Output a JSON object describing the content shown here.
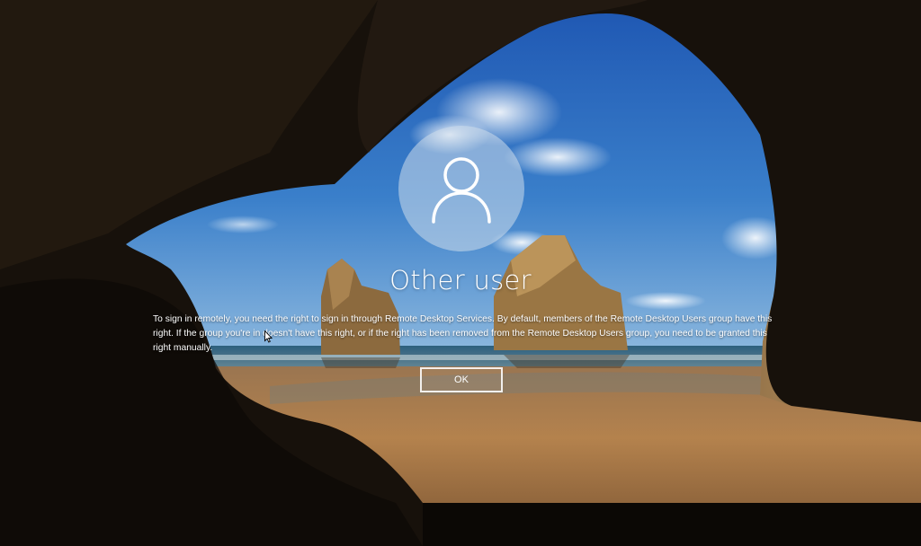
{
  "lock_screen": {
    "user": {
      "avatar_icon": "user-silhouette-icon",
      "name": "Other user"
    },
    "message": "To sign in remotely, you need the right to sign in through Remote Desktop Services. By default, members of the Remote Desktop Users group have this right. If the group you're in doesn't have this right, or if the right has been removed from the Remote Desktop Users group, you need to be granted this right manually.",
    "ok_label": "OK"
  },
  "pointer": {
    "icon": "mouse-pointer-icon"
  },
  "colors": {
    "text": "#ffffff",
    "avatar_fill": "#cddceb",
    "sky_top": "#2a5fb0",
    "sand": "#b07e4a",
    "cave_rock": "#1f1810"
  }
}
